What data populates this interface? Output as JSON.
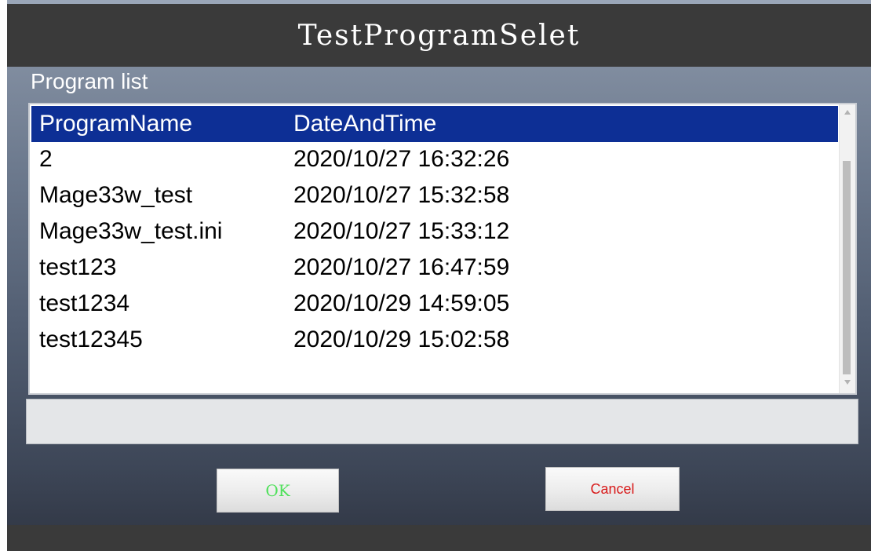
{
  "window": {
    "title": "TestProgramSelet"
  },
  "program_list": {
    "label": "Program list",
    "columns": {
      "name": "ProgramName",
      "date": "DateAndTime"
    },
    "rows": [
      {
        "name": "2",
        "date": "2020/10/27 16:32:26"
      },
      {
        "name": "Mage33w_test",
        "date": "2020/10/27 15:32:58"
      },
      {
        "name": "Mage33w_test.ini",
        "date": "2020/10/27 15:33:12"
      },
      {
        "name": "test123",
        "date": "2020/10/27 16:47:59"
      },
      {
        "name": "test1234",
        "date": "2020/10/29 14:59:05"
      },
      {
        "name": "test12345",
        "date": "2020/10/29 15:02:58"
      }
    ],
    "scroll_up_icon": "triangle-up-icon",
    "scroll_down_icon": "triangle-down-icon"
  },
  "status_field": {
    "value": ""
  },
  "buttons": {
    "ok_label": "OK",
    "cancel_label": "Cancel"
  },
  "colors": {
    "title_bar": "#3a3a3a",
    "header_row": "#0d2f95",
    "ok_text": "#4fe05a",
    "cancel_text": "#d81b1b"
  }
}
